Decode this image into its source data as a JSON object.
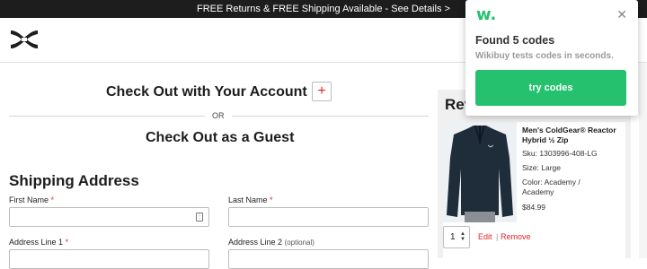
{
  "promo_bar": {
    "text": "FREE Returns & FREE Shipping Available - See Details >",
    "right_fragment": "n"
  },
  "header": {
    "logo_icon": "under-armour-logo"
  },
  "checkout": {
    "account_heading": "Check Out with Your Account",
    "account_button_label": "+",
    "or_label": "OR",
    "guest_heading": "Check Out as a Guest"
  },
  "shipping": {
    "heading": "Shipping Address",
    "fields": {
      "first_name": {
        "label": "First Name",
        "required": "*",
        "value": ""
      },
      "last_name": {
        "label": "Last Name",
        "required": "*",
        "value": ""
      },
      "address1": {
        "label": "Address Line 1",
        "required": "*"
      },
      "address2": {
        "label": "Address Line 2",
        "optional": "(optional)"
      }
    }
  },
  "review": {
    "title": "Rev",
    "item": {
      "name": "Men's ColdGear® Reactor Hybrid ½ Zip",
      "sku": "Sku: 1303996-408-LG",
      "size": "Size: Large",
      "color": "Color: Academy / Academy",
      "price": "$84.99",
      "quantity": "1",
      "edit_label": "Edit",
      "separator": "|",
      "remove_label": "Remove"
    }
  },
  "popup": {
    "logo": "w.",
    "close_icon": "close-icon",
    "title": "Found 5 codes",
    "subtitle": "Wikibuy tests codes in seconds.",
    "button_label": "try codes",
    "accent": "#25c16f"
  },
  "colors": {
    "accent_red": "#e1262b",
    "dark": "#1d1d1d"
  }
}
